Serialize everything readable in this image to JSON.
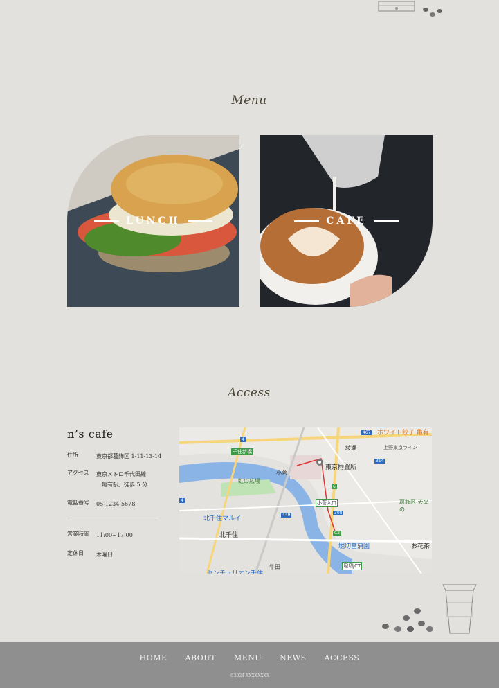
{
  "menu": {
    "title": "Menu",
    "cards": [
      {
        "label": "LUNCH"
      },
      {
        "label": "CAFE"
      }
    ]
  },
  "access": {
    "title": "Access",
    "shop_name": "n’s cafe",
    "rows": [
      {
        "key": "住所",
        "value": "東京都葛飾区 1-11-13-14"
      },
      {
        "key": "アクセス",
        "value_line1": "東京メトロ千代田線",
        "value_line2": "「亀有駅」徒歩 5 分"
      },
      {
        "key": "電話番号",
        "value": "05-1234-5678"
      },
      {
        "key": "営業時間",
        "value": "11:00~17:00"
      },
      {
        "key": "定休日",
        "value": "木曜日"
      }
    ]
  },
  "map": {
    "labels": [
      "ホワイト餃子 亀有",
      "綾瀬",
      "上野東京ライン",
      "東京拘置所",
      "千住新橋",
      "虹の広場",
      "小菅",
      "小菅入口",
      "北千住マルイ",
      "北千住",
      "葛飾区 天文の",
      "堀切菖蒲園",
      "お花茶",
      "堀切JCT",
      "牛田",
      "センチュリオン千住"
    ],
    "route_numbers": [
      "4",
      "467",
      "314",
      "6",
      "308",
      "449",
      "C2",
      "4"
    ]
  },
  "footer": {
    "nav": [
      "HOME",
      "ABOUT",
      "MENU",
      "NEWS",
      "ACCESS"
    ],
    "copyright": "©2024 XXXXXXXX"
  }
}
